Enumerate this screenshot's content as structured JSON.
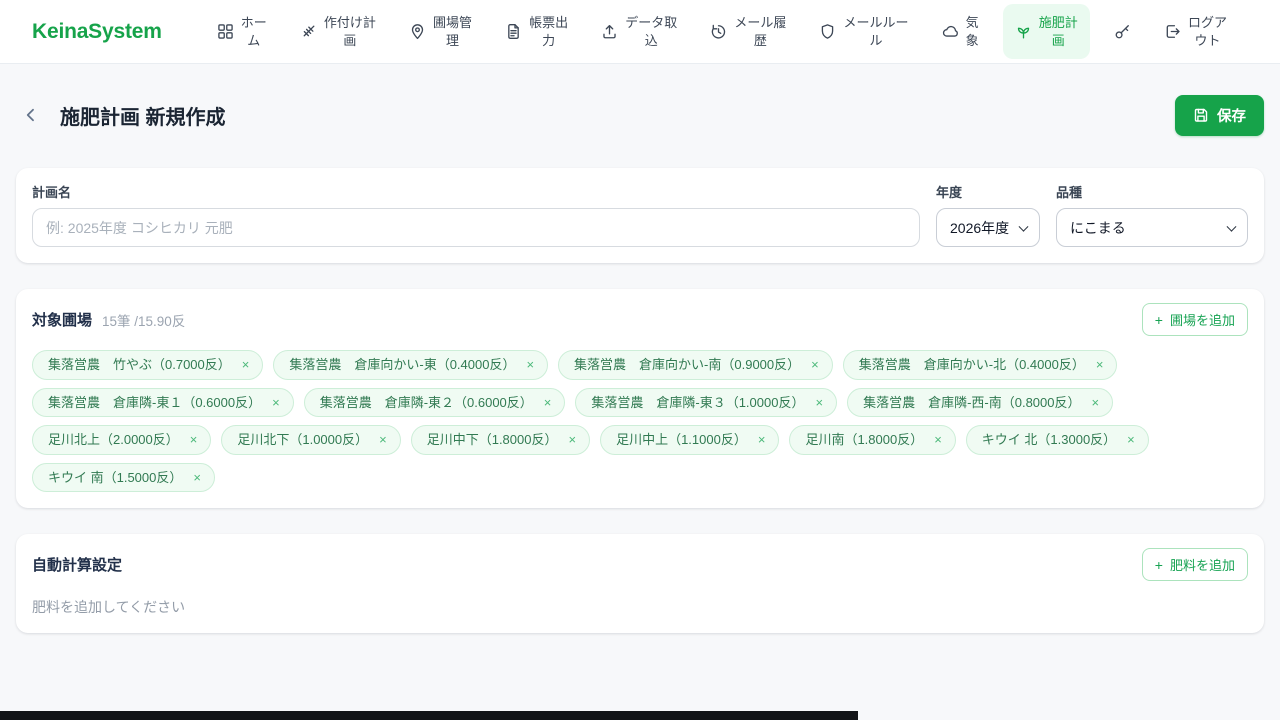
{
  "brand": "KeinaSystem",
  "nav": {
    "items": [
      {
        "label": "ホー\nム"
      },
      {
        "label": "作付け計\n画"
      },
      {
        "label": "圃場管\n理"
      },
      {
        "label": "帳票出\n力"
      },
      {
        "label": "データ取\n込"
      },
      {
        "label": "メール履\n歴"
      },
      {
        "label": "メールルー\nル"
      },
      {
        "label": "気\n象"
      },
      {
        "label": "施肥計\n画"
      },
      {
        "label": "ログア\nウト"
      }
    ]
  },
  "page": {
    "title": "施肥計画 新規作成",
    "save_label": "保存"
  },
  "plan_form": {
    "name_label": "計画名",
    "name_placeholder": "例: 2025年度 コシヒカリ 元肥",
    "year_label": "年度",
    "year_value": "2026年度",
    "variety_label": "品種",
    "variety_value": "にこまる"
  },
  "fields": {
    "title": "対象圃場",
    "summary": "15筆 /15.90反",
    "add_label": "圃場を追加",
    "chips": [
      "集落営農　竹やぶ（0.7000反）",
      "集落営農　倉庫向かい-東（0.4000反）",
      "集落営農　倉庫向かい-南（0.9000反）",
      "集落営農　倉庫向かい-北（0.4000反）",
      "集落営農　倉庫隣-東１（0.6000反）",
      "集落営農　倉庫隣-東２（0.6000反）",
      "集落営農　倉庫隣-東３（1.0000反）",
      "集落営農　倉庫隣-西-南（0.8000反）",
      "足川北上（2.0000反）",
      "足川北下（1.0000反）",
      "足川中下（1.8000反）",
      "足川中上（1.1000反）",
      "足川南（1.8000反）",
      "キウイ 北（1.3000反）",
      "キウイ 南（1.5000反）"
    ]
  },
  "fertilizer": {
    "title": "自動計算設定",
    "add_label": "肥料を追加",
    "empty_text": "肥料を追加してください"
  },
  "ui": {
    "plus_glyph": "+",
    "remove_glyph": "×"
  },
  "colors": {
    "accent_green": "#16a34a",
    "active_nav_bg": "#eafaf0",
    "chip_bg": "#f0fbf3",
    "chip_border": "#cdeed8",
    "chip_text": "#317a52",
    "page_bg": "#f7f8fa"
  }
}
